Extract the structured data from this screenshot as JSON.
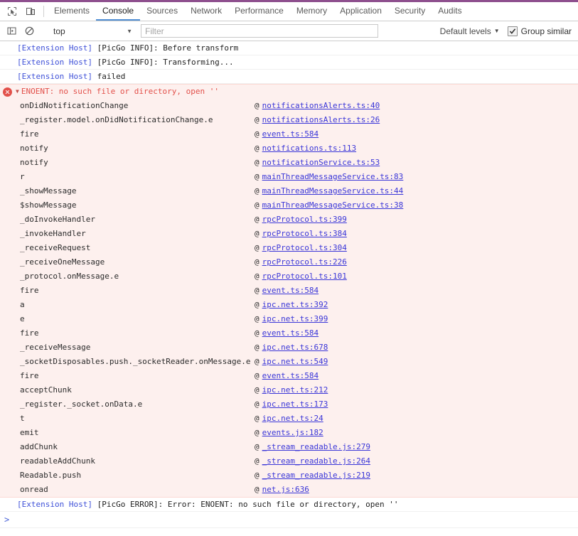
{
  "window": {
    "accent_color": "#8e4f8e"
  },
  "toolbar": {
    "inspect_icon": "inspect-element-icon",
    "device_icon": "device-toolbar-icon",
    "tabs": [
      {
        "label": "Elements",
        "active": false
      },
      {
        "label": "Console",
        "active": true
      },
      {
        "label": "Sources",
        "active": false
      },
      {
        "label": "Network",
        "active": false
      },
      {
        "label": "Performance",
        "active": false
      },
      {
        "label": "Memory",
        "active": false
      },
      {
        "label": "Application",
        "active": false
      },
      {
        "label": "Security",
        "active": false
      },
      {
        "label": "Audits",
        "active": false
      }
    ]
  },
  "filterbar": {
    "sidebar_icon": "console-sidebar-icon",
    "clear_icon": "clear-console-icon",
    "context_value": "top",
    "context_caret": "▼",
    "filter_placeholder": "Filter",
    "filter_value": "",
    "levels_label": "Default levels",
    "levels_caret": "▼",
    "group_similar_label": "Group similar",
    "group_similar_checked": true
  },
  "console": {
    "messages": [
      {
        "prefix": "[Extension Host]",
        "text": " [PicGo INFO]: Before transform"
      },
      {
        "prefix": "[Extension Host]",
        "text": " [PicGo INFO]: Transforming..."
      },
      {
        "prefix": "[Extension Host]",
        "text": " failed"
      }
    ],
    "error": {
      "caret": "▼",
      "title": "ENOENT: no such file or directory, open ''",
      "stack": [
        {
          "fn": "onDidNotificationChange",
          "at": "@",
          "link": "notificationsAlerts.ts:40"
        },
        {
          "fn": "_register.model.onDidNotificationChange.e",
          "at": "@",
          "link": "notificationsAlerts.ts:26"
        },
        {
          "fn": "fire",
          "at": "@",
          "link": "event.ts:584"
        },
        {
          "fn": "notify",
          "at": "@",
          "link": "notifications.ts:113"
        },
        {
          "fn": "notify",
          "at": "@",
          "link": "notificationService.ts:53"
        },
        {
          "fn": "r",
          "at": "@",
          "link": "mainThreadMessageService.ts:83"
        },
        {
          "fn": "_showMessage",
          "at": "@",
          "link": "mainThreadMessageService.ts:44"
        },
        {
          "fn": "$showMessage",
          "at": "@",
          "link": "mainThreadMessageService.ts:38"
        },
        {
          "fn": "_doInvokeHandler",
          "at": "@",
          "link": "rpcProtocol.ts:399"
        },
        {
          "fn": "_invokeHandler",
          "at": "@",
          "link": "rpcProtocol.ts:384"
        },
        {
          "fn": "_receiveRequest",
          "at": "@",
          "link": "rpcProtocol.ts:304"
        },
        {
          "fn": "_receiveOneMessage",
          "at": "@",
          "link": "rpcProtocol.ts:226"
        },
        {
          "fn": "_protocol.onMessage.e",
          "at": "@",
          "link": "rpcProtocol.ts:101"
        },
        {
          "fn": "fire",
          "at": "@",
          "link": "event.ts:584"
        },
        {
          "fn": "a",
          "at": "@",
          "link": "ipc.net.ts:392"
        },
        {
          "fn": "e",
          "at": "@",
          "link": "ipc.net.ts:399"
        },
        {
          "fn": "fire",
          "at": "@",
          "link": "event.ts:584"
        },
        {
          "fn": "_receiveMessage",
          "at": "@",
          "link": "ipc.net.ts:678"
        },
        {
          "fn": "_socketDisposables.push._socketReader.onMessage.e",
          "at": "@",
          "link": "ipc.net.ts:549"
        },
        {
          "fn": "fire",
          "at": "@",
          "link": "event.ts:584"
        },
        {
          "fn": "acceptChunk",
          "at": "@",
          "link": "ipc.net.ts:212"
        },
        {
          "fn": "_register._socket.onData.e",
          "at": "@",
          "link": "ipc.net.ts:173"
        },
        {
          "fn": "t",
          "at": "@",
          "link": "ipc.net.ts:24"
        },
        {
          "fn": "emit",
          "at": "@",
          "link": "events.js:182"
        },
        {
          "fn": "addChunk",
          "at": "@",
          "link": "_stream_readable.js:279"
        },
        {
          "fn": "readableAddChunk",
          "at": "@",
          "link": "_stream_readable.js:264"
        },
        {
          "fn": "Readable.push",
          "at": "@",
          "link": "_stream_readable.js:219"
        },
        {
          "fn": "onread",
          "at": "@",
          "link": "net.js:636"
        }
      ]
    },
    "trailing_messages": [
      {
        "prefix": "[Extension Host]",
        "text": " [PicGo ERROR]: Error: ENOENT: no such file or directory, open ''"
      }
    ],
    "prompt_caret": ">",
    "prompt_value": ""
  }
}
